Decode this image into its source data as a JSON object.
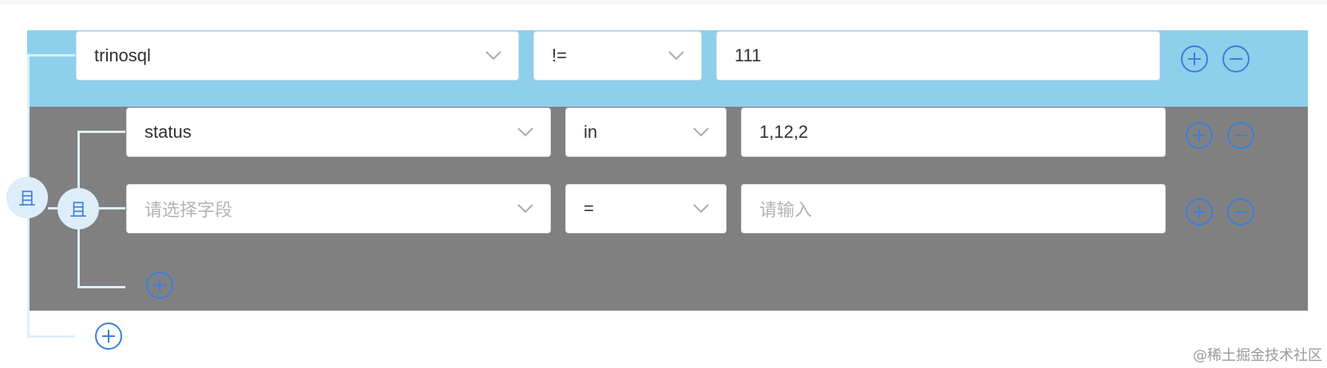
{
  "root_group": {
    "logic_label": "且",
    "condition": {
      "field": "trinosql",
      "operator": "!=",
      "value": "111"
    },
    "add_icon": "plus-circle-icon",
    "remove_icon": "minus-circle-icon"
  },
  "nested_group": {
    "logic_label": "且",
    "conditions": [
      {
        "field": "status",
        "operator": "in",
        "value": "1,12,2"
      },
      {
        "field_placeholder": "请选择字段",
        "operator": "=",
        "value_placeholder": "请输入"
      }
    ]
  },
  "watermark": "@稀土掘金技术社区",
  "colors": {
    "accent": "#3a7ee0",
    "band_blue": "#8ecfec",
    "band_gray": "#808080",
    "badge_bg": "#ddeefa",
    "connector": "#ddeffa"
  }
}
